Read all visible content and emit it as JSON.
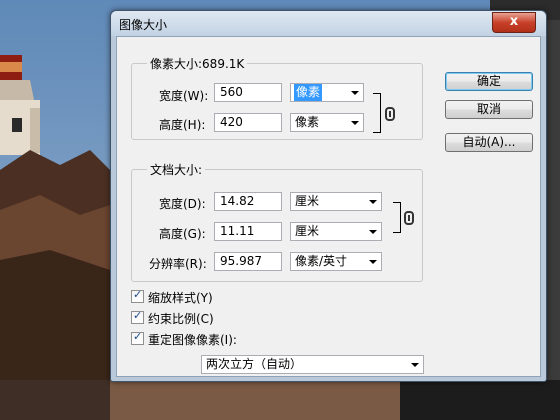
{
  "window": {
    "title": "图像大小",
    "close_glyph": "x"
  },
  "pixel_dimensions": {
    "legend": "像素大小:689.1K",
    "width_label": "宽度(W):",
    "width_value": "560",
    "width_unit": "像素",
    "height_label": "高度(H):",
    "height_value": "420",
    "height_unit": "像素"
  },
  "document_size": {
    "legend": "文档大小:",
    "width_label": "宽度(D):",
    "width_value": "14.82",
    "width_unit": "厘米",
    "height_label": "高度(G):",
    "height_value": "11.11",
    "height_unit": "厘米",
    "resolution_label": "分辨率(R):",
    "resolution_value": "95.987",
    "resolution_unit": "像素/英寸"
  },
  "buttons": {
    "ok": "确定",
    "cancel": "取消",
    "auto": "自动(A)..."
  },
  "options": {
    "scale_styles": {
      "label": "缩放样式(Y)",
      "checked": true
    },
    "constrain": {
      "label": "约束比例(C)",
      "checked": true
    },
    "resample": {
      "label": "重定图像像素(I):",
      "checked": true
    },
    "resample_method": "两次立方（自动）",
    "check_glyph": "✓"
  },
  "colors": {
    "accent": "#3399ff",
    "title_bar": "#c2d2e3",
    "close_button": "#c8412a"
  }
}
